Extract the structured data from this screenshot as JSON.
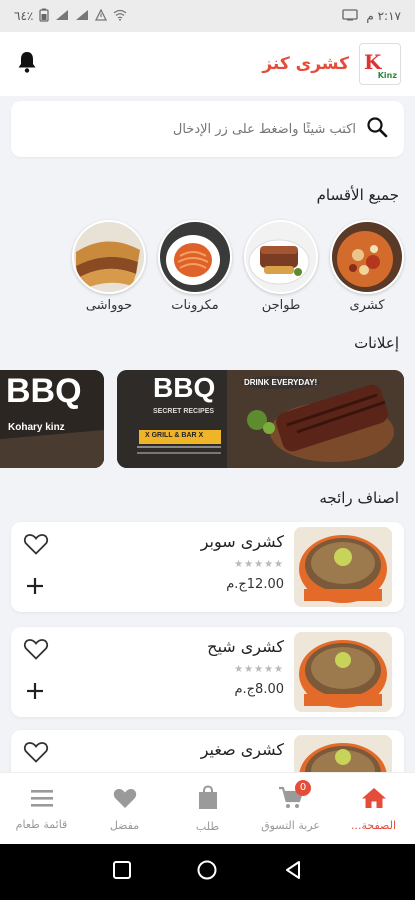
{
  "status_bar": {
    "battery": "٦٤٪",
    "time": "٢:١٧ م"
  },
  "header": {
    "app_name": "كشرى كنز",
    "logo_text": "Kinz"
  },
  "search": {
    "placeholder": "اكتب شيئًا واضغط على زر الإدخال"
  },
  "categories_section": {
    "title": "جميع الأقسام",
    "items": [
      {
        "label": "كشرى"
      },
      {
        "label": "طواجن"
      },
      {
        "label": "مكرونات"
      },
      {
        "label": "حوواشى"
      }
    ]
  },
  "ads_section": {
    "title": "إعلانات",
    "ad1": {
      "title": "BBQ",
      "subtitle": "SECRET RECIPES",
      "tagline": "DRINK EVERYDAY!",
      "bar": "X GRILL & BAR X"
    },
    "ad2": {
      "title": "BBQ",
      "subtitle": "Kohary kinz"
    }
  },
  "popular_section": {
    "title": "اصناف رائجه",
    "products": [
      {
        "name": "كشرى سوبر",
        "price": "12.00ج.م",
        "stars": "★★★★★"
      },
      {
        "name": "كشرى شيح",
        "price": "8.00ج.م",
        "stars": "★★★★★"
      },
      {
        "name": "كشرى صغير",
        "price": "",
        "stars": ""
      }
    ]
  },
  "bottom_nav": {
    "items": [
      {
        "label": "الصفحة..."
      },
      {
        "label": "عربة التسوق",
        "badge": "0"
      },
      {
        "label": "طلب"
      },
      {
        "label": "مفضل"
      },
      {
        "label": "قائمة طعام"
      }
    ]
  },
  "colors": {
    "accent": "#e44d3a",
    "background": "#f1f3f7"
  }
}
